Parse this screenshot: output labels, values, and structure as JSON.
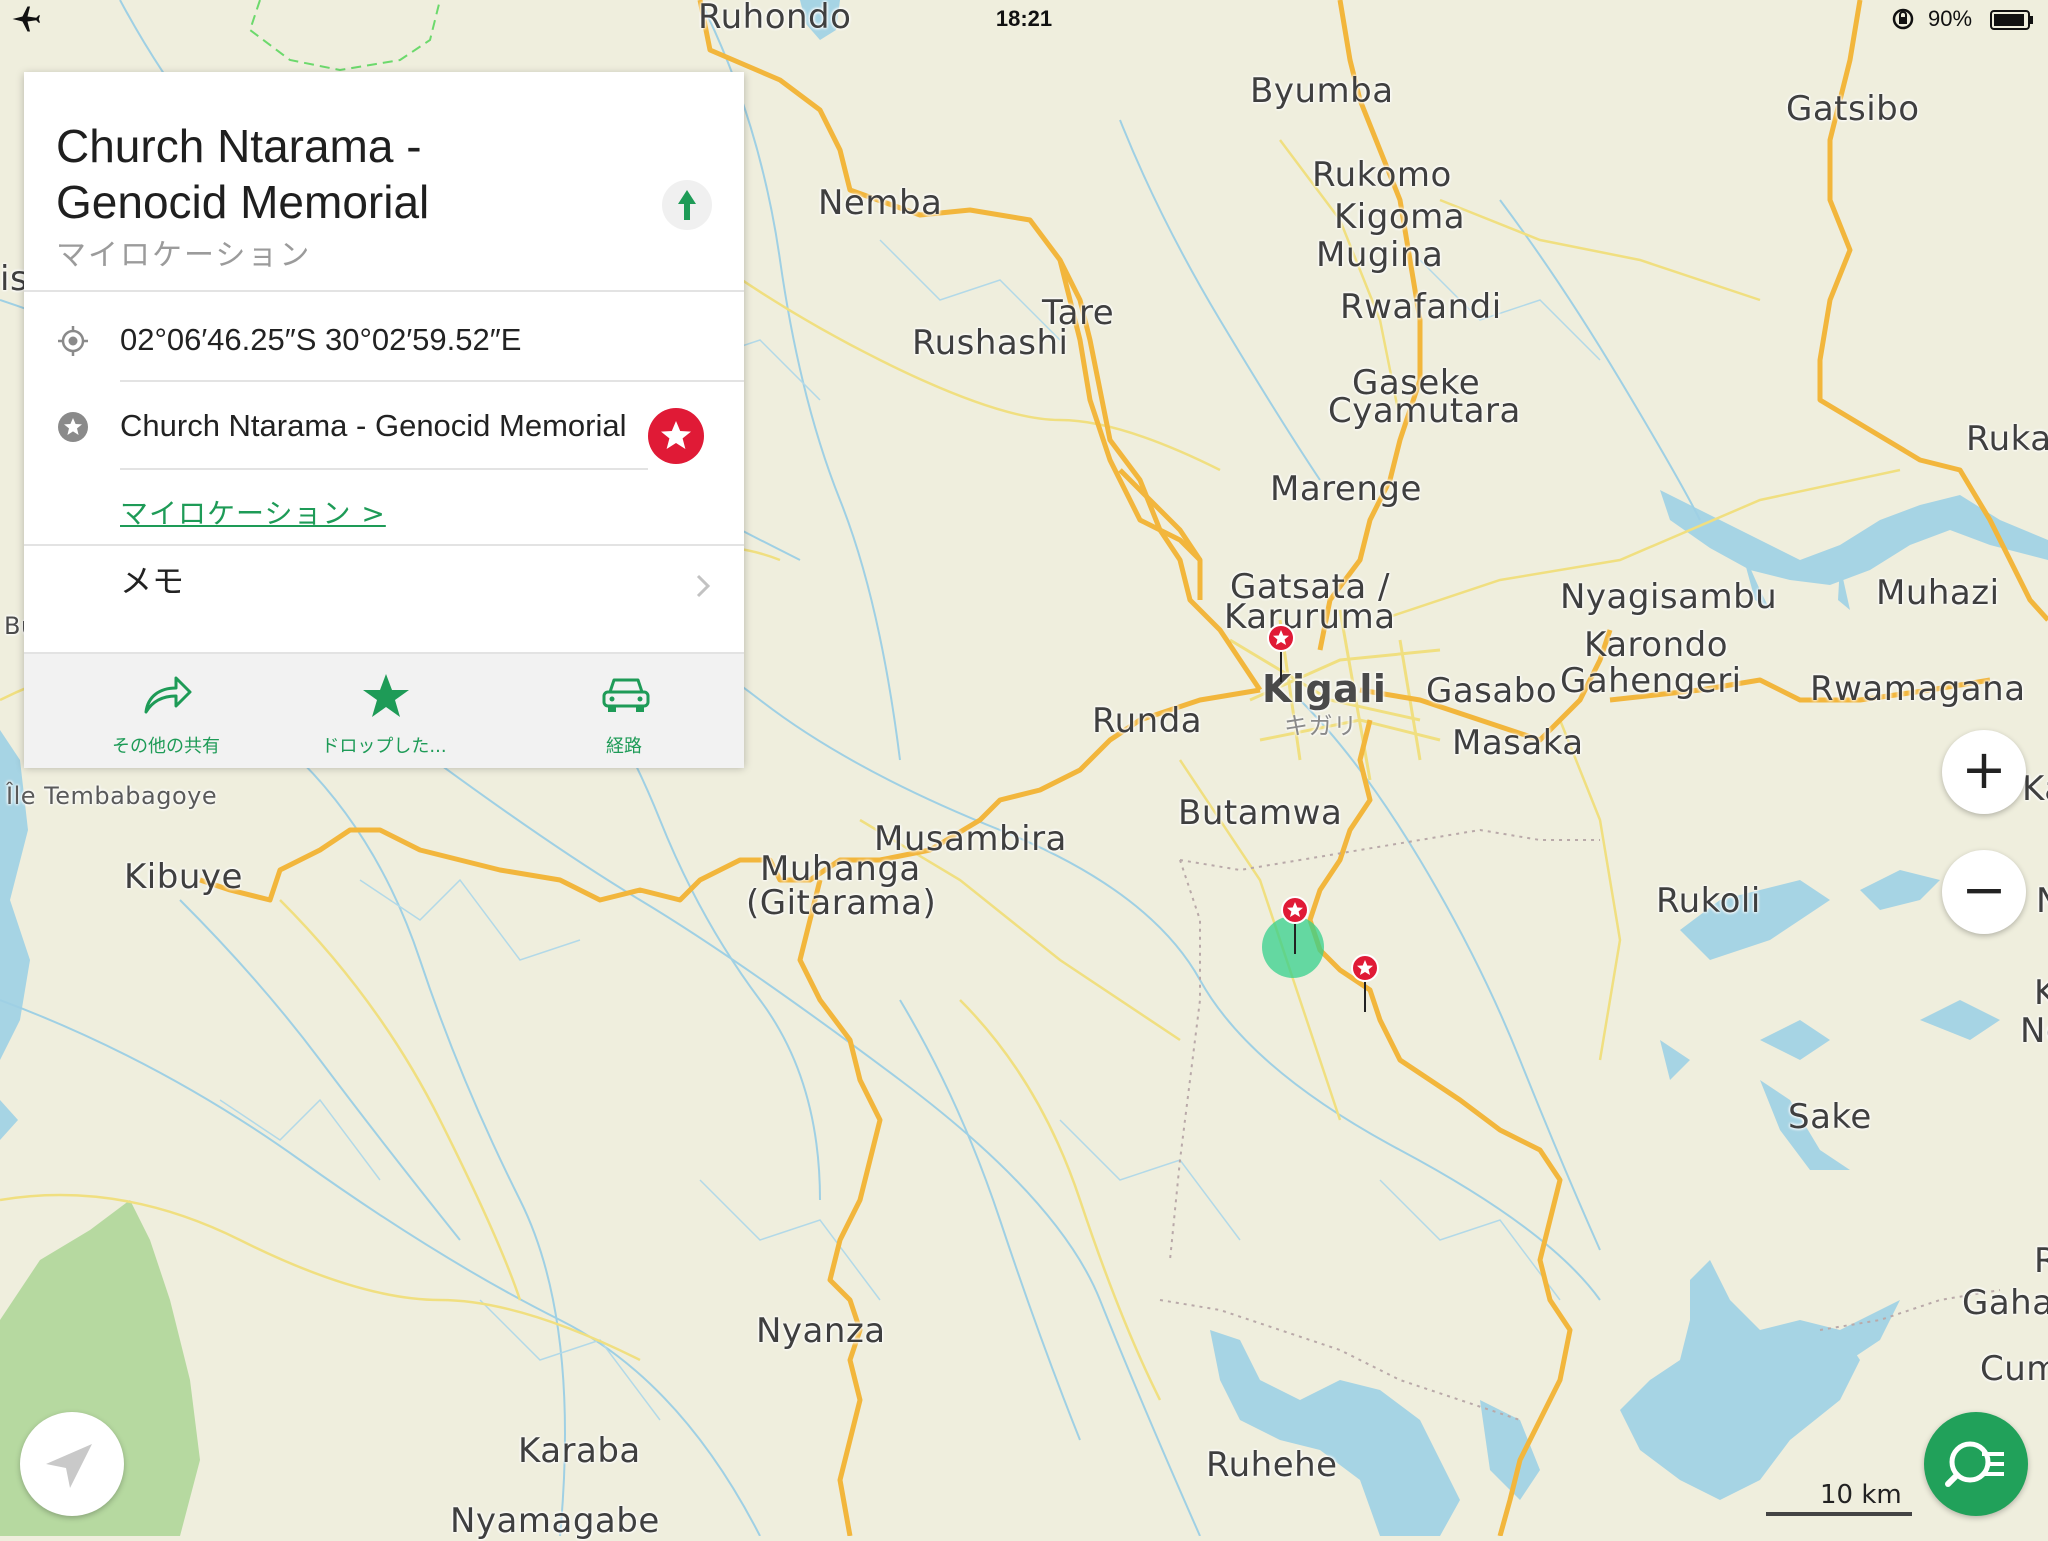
{
  "status_bar": {
    "time": "18:21",
    "battery_text": "90%",
    "icons": [
      "airplane-mode-icon",
      "rotation-lock-icon",
      "battery-icon"
    ]
  },
  "map": {
    "labels": {
      "ruhondo": "Ruhondo",
      "byumba": "Byumba",
      "gatsibo": "Gatsibo",
      "rukomo": "Rukomo",
      "kigoma": "Kigoma",
      "mugina": "Mugina",
      "rwafandi": "Rwafandi",
      "nemba": "Nemba",
      "tare": "Tare",
      "rushashi": "Rushashi",
      "gaseke": "Gaseke",
      "cyamutara": "Cyamutara",
      "ruka": "Ruka",
      "marenge": "Marenge",
      "gatsata": "Gatsata /",
      "karuruma": "Karuruma",
      "nyagisambu": "Nyagisambu",
      "muhazi": "Muhazi",
      "karondo": "Karondo",
      "gahengeri": "Gahengeri",
      "rwamagana": "Rwamagana",
      "kigali": "Kigali",
      "kigali_ja": "キガリ",
      "gasabo": "Gasabo",
      "masaka": "Masaka",
      "runda": "Runda",
      "butamwa": "Butamwa",
      "musambira": "Musambira",
      "muhanga": "Muhanga",
      "gitarama": "(Gitarama)",
      "ile_tembabagoye": "Île Tembabagoye",
      "kibuye": "Kibuye",
      "rukoli": "Rukoli",
      "sake": "Sake",
      "nyanza": "Nyanza",
      "karaba": "Karaba",
      "ruhehe": "Ruhehe",
      "nyamagabe": "Nyamagabe",
      "gaha": "Gaha",
      "cum": "Cum",
      "edge_is": "is",
      "edge_bu": "Bu",
      "edge_ka": "Ka",
      "edge_k": "K",
      "edge_n": "N",
      "edge_r": "R",
      "edge_no": "No",
      "edge_l": "I",
      "edge_o": "o"
    },
    "scale_label": "10 km",
    "colors": {
      "land": "#efeedd",
      "water": "#a6d4e4",
      "major_road": "#f2b63c",
      "minor_road": "#f0df80",
      "forest": "#b6d9a0",
      "pin": "#e01a36",
      "accent": "#1e9b57"
    }
  },
  "place_card": {
    "title_line1": "Church Ntarama -",
    "title_line2": "Genocid Memorial",
    "subtitle": "マイロケーション",
    "coordinates": "02°06′46.25″S 30°02′59.52″E",
    "bookmark_name": "Church Ntarama - Genocid Memorial",
    "bookmark_set_link": "マイロケーション >",
    "memo_label": "メモ",
    "toolbar": {
      "share": "その他の共有",
      "dropped": "ドロップした...",
      "route": "経路"
    }
  },
  "controls": {
    "zoom_in": "+",
    "zoom_out": "−"
  }
}
